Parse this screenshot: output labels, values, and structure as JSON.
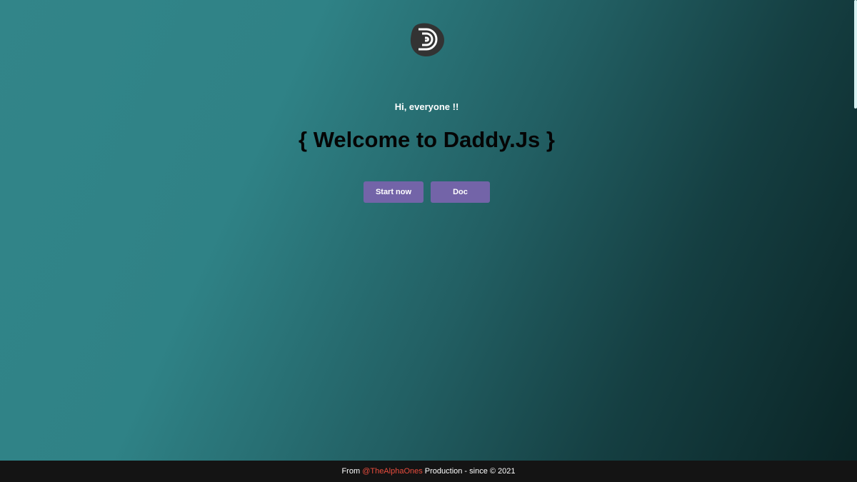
{
  "colors": {
    "button_bg": "#7364a8",
    "footer_bg": "#141414",
    "handle_color": "#e84c3d",
    "logo_bg": "#333333"
  },
  "logo": {
    "icon": "daddyjs-logo-icon"
  },
  "hero": {
    "greeting": "Hi, everyone !!",
    "title": "{ Welcome to Daddy.Js }"
  },
  "buttons": {
    "start": "Start now",
    "doc": "Doc"
  },
  "footer": {
    "prefix": "From ",
    "handle": "@TheAlphaOnes",
    "suffix": " Production - since © 2021"
  }
}
